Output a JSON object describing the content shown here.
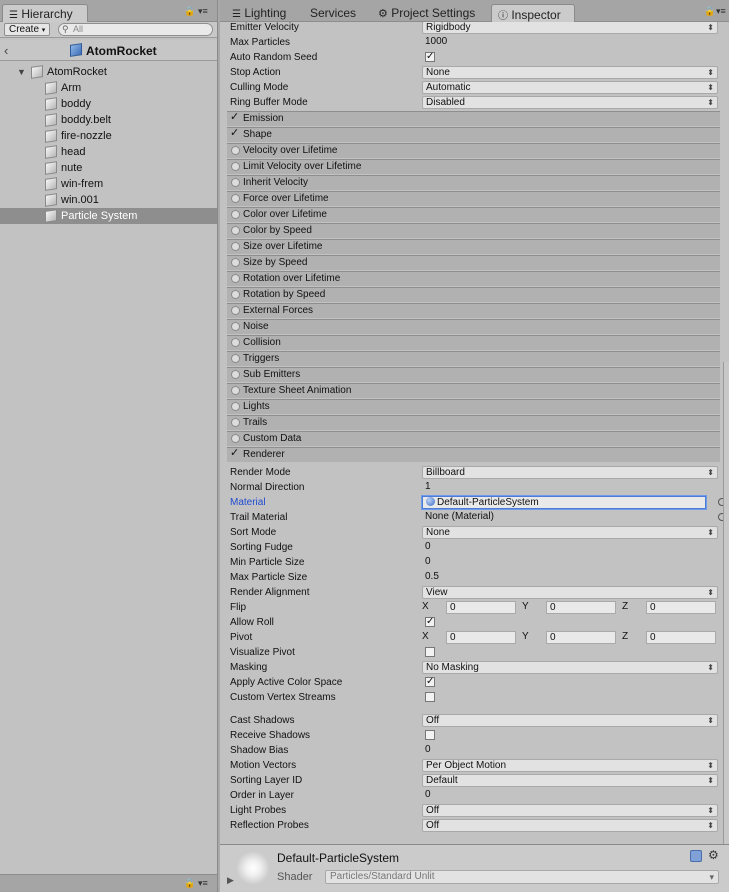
{
  "hierarchy": {
    "tab_label": "Hierarchy",
    "create_label": "Create",
    "search_placeholder": "All",
    "scene_title": "AtomRocket",
    "root": "AtomRocket",
    "children": [
      "Arm",
      "boddy",
      "boddy.belt",
      "fire-nozzle",
      "head",
      "nute",
      "win-frem",
      "win.001",
      "Particle System"
    ],
    "selected": "Particle System"
  },
  "tabs": [
    "Lighting",
    "Services",
    "Project Settings",
    "Inspector"
  ],
  "active_tab": "Inspector",
  "top_props": [
    {
      "label": "Emitter Velocity",
      "value": "Rigidbody",
      "kind": "drop"
    },
    {
      "label": "Max Particles",
      "value": "1000",
      "kind": "field"
    },
    {
      "label": "Auto Random Seed",
      "value": "✓",
      "kind": "check"
    },
    {
      "label": "Stop Action",
      "value": "None",
      "kind": "drop"
    },
    {
      "label": "Culling Mode",
      "value": "Automatic",
      "kind": "drop"
    },
    {
      "label": "Ring Buffer Mode",
      "value": "Disabled",
      "kind": "drop"
    }
  ],
  "modules": [
    {
      "label": "Emission",
      "enabled": true
    },
    {
      "label": "Shape",
      "enabled": true
    },
    {
      "label": "Velocity over Lifetime",
      "enabled": false
    },
    {
      "label": "Limit Velocity over Lifetime",
      "enabled": false
    },
    {
      "label": "Inherit Velocity",
      "enabled": false
    },
    {
      "label": "Force over Lifetime",
      "enabled": false
    },
    {
      "label": "Color over Lifetime",
      "enabled": false
    },
    {
      "label": "Color by Speed",
      "enabled": false
    },
    {
      "label": "Size over Lifetime",
      "enabled": false
    },
    {
      "label": "Size by Speed",
      "enabled": false
    },
    {
      "label": "Rotation over Lifetime",
      "enabled": false
    },
    {
      "label": "Rotation by Speed",
      "enabled": false
    },
    {
      "label": "External Forces",
      "enabled": false
    },
    {
      "label": "Noise",
      "enabled": false
    },
    {
      "label": "Collision",
      "enabled": false
    },
    {
      "label": "Triggers",
      "enabled": false
    },
    {
      "label": "Sub Emitters",
      "enabled": false
    },
    {
      "label": "Texture Sheet Animation",
      "enabled": false
    },
    {
      "label": "Lights",
      "enabled": false
    },
    {
      "label": "Trails",
      "enabled": false
    },
    {
      "label": "Custom Data",
      "enabled": false
    },
    {
      "label": "Renderer",
      "enabled": true
    }
  ],
  "renderer": {
    "render_mode": {
      "label": "Render Mode",
      "value": "Billboard"
    },
    "normal_direction": {
      "label": "Normal Direction",
      "value": "1"
    },
    "material": {
      "label": "Material",
      "value": "Default-ParticleSystem"
    },
    "trail_material": {
      "label": "Trail Material",
      "value": "None (Material)"
    },
    "sort_mode": {
      "label": "Sort Mode",
      "value": "None"
    },
    "sorting_fudge": {
      "label": "Sorting Fudge",
      "value": "0"
    },
    "min_particle_size": {
      "label": "Min Particle Size",
      "value": "0"
    },
    "max_particle_size": {
      "label": "Max Particle Size",
      "value": "0.5"
    },
    "render_alignment": {
      "label": "Render Alignment",
      "value": "View"
    },
    "flip": {
      "label": "Flip",
      "x": "0",
      "y": "0",
      "z": "0"
    },
    "allow_roll": {
      "label": "Allow Roll",
      "value": "✓"
    },
    "pivot": {
      "label": "Pivot",
      "x": "0",
      "y": "0",
      "z": "0"
    },
    "visualize_pivot": {
      "label": "Visualize Pivot",
      "value": ""
    },
    "masking": {
      "label": "Masking",
      "value": "No Masking"
    },
    "apply_active_color_space": {
      "label": "Apply Active Color Space",
      "value": "✓"
    },
    "custom_vertex_streams": {
      "label": "Custom Vertex Streams",
      "value": ""
    },
    "cast_shadows": {
      "label": "Cast Shadows",
      "value": "Off"
    },
    "receive_shadows": {
      "label": "Receive Shadows",
      "value": ""
    },
    "shadow_bias": {
      "label": "Shadow Bias",
      "value": "0"
    },
    "motion_vectors": {
      "label": "Motion Vectors",
      "value": "Per Object Motion"
    },
    "sorting_layer_id": {
      "label": "Sorting Layer ID",
      "value": "Default"
    },
    "order_in_layer": {
      "label": "Order in Layer",
      "value": "0"
    },
    "light_probes": {
      "label": "Light Probes",
      "value": "Off"
    },
    "reflection_probes": {
      "label": "Reflection Probes",
      "value": "Off"
    }
  },
  "axes": {
    "x": "X",
    "y": "Y",
    "z": "Z"
  },
  "material_preview": {
    "name": "Default-ParticleSystem",
    "shader_label": "Shader",
    "shader_value": "Particles/Standard Unlit"
  }
}
